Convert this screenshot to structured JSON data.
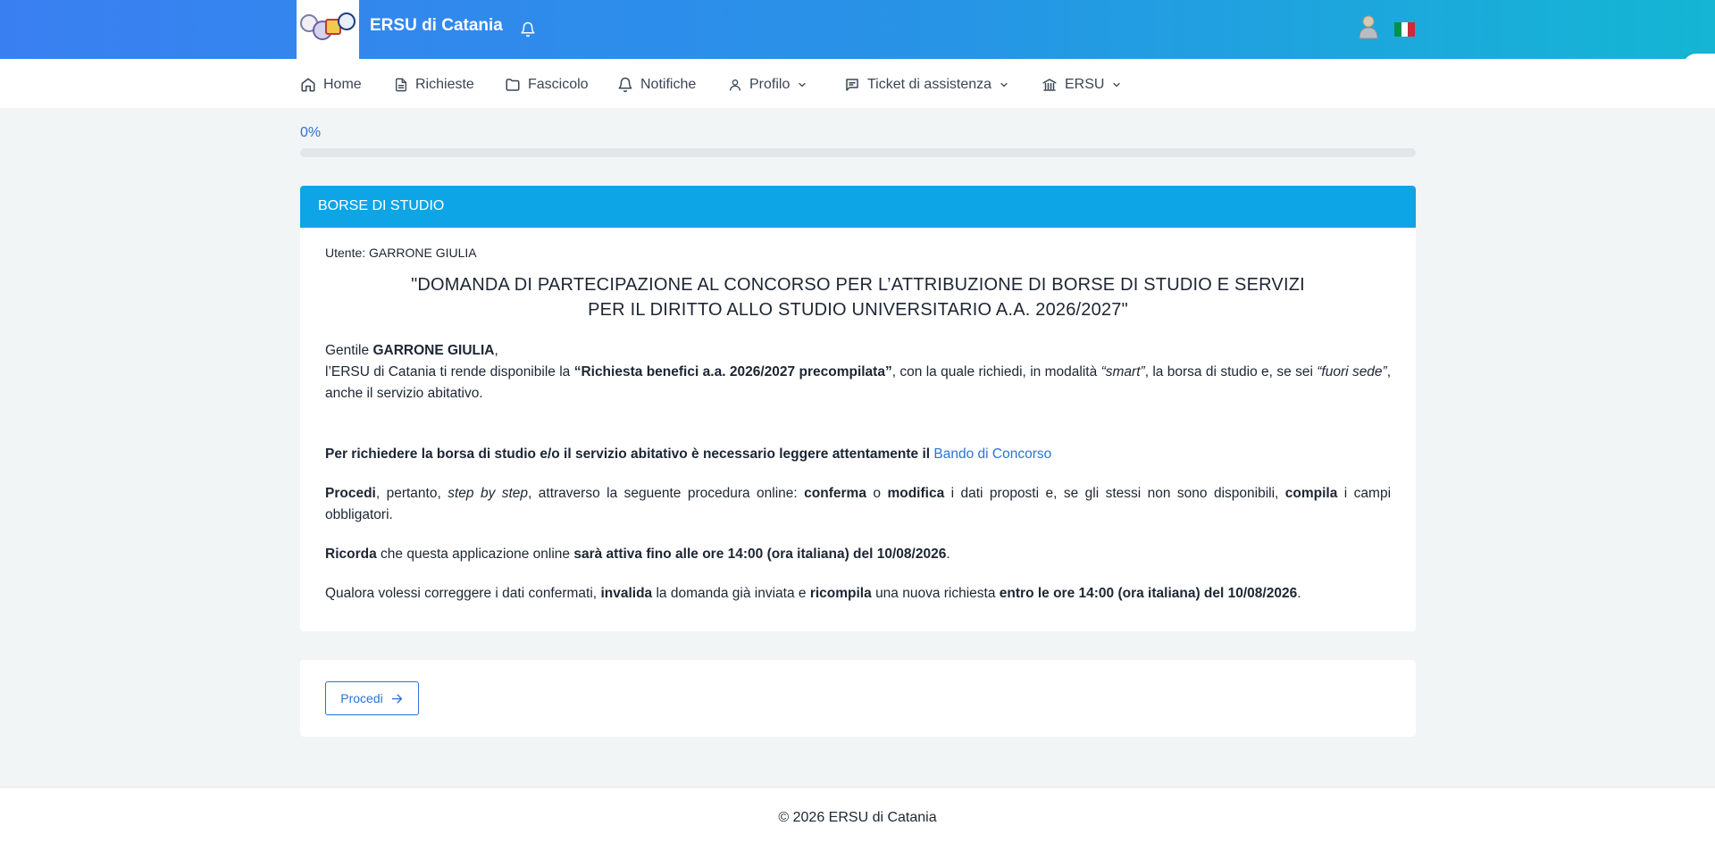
{
  "header": {
    "brand": "ERSU di Catania",
    "logo_icon": "ersu-logo",
    "notification_icon": "bell-icon",
    "user_icon": "user-avatar-icon",
    "language_icon": "italian-flag-icon"
  },
  "nav": {
    "items": [
      {
        "label": "Home",
        "icon": "home-icon"
      },
      {
        "label": "Richieste",
        "icon": "document-icon"
      },
      {
        "label": "Fascicolo",
        "icon": "folder-icon"
      },
      {
        "label": "Notifiche",
        "icon": "bell-icon"
      },
      {
        "label": "Profilo",
        "icon": "user-icon",
        "dropdown": true
      },
      {
        "label": "Ticket di assistenza",
        "icon": "chat-icon",
        "dropdown": true
      },
      {
        "label": "ERSU",
        "icon": "bank-icon",
        "dropdown": true
      }
    ]
  },
  "progress": {
    "label": "0%",
    "value": 0
  },
  "card": {
    "header": "BORSE DI STUDIO",
    "utente_label": "Utente:",
    "utente_name": "GARRONE GIULIA",
    "title_line1": "\"DOMANDA DI PARTECIPAZIONE AL CONCORSO PER L’ATTRIBUZIONE DI BORSE DI STUDIO E SERVIZI",
    "title_line2": "PER IL DIRITTO ALLO STUDIO UNIVERSITARIO A.A. 2026/2027\"",
    "greeting_prefix": "Gentile",
    "greeting_name": "GARRONE GIULIA",
    "greeting_suffix": ",",
    "intro_1": "l’ERSU di Catania ti rende disponibile la",
    "intro_bold": "“Richiesta benefici a.a. 2026/2027 precompilata”",
    "intro_2": ", con la quale richiedi, in modalità",
    "intro_smart": "“smart”",
    "intro_3": ", la borsa di studio e, se sei",
    "intro_fuori": "“fuori sede”",
    "intro_4": ", anche il servizio abitativo.",
    "bando_text": "Per richiedere la borsa di studio e/o il servizio abitativo è necessario leggere attentamente il",
    "bando_link": "Bando di Concorso",
    "procedi_bold": "Procedi",
    "procedi_1": ", pertanto,",
    "procedi_italic": "step by step",
    "procedi_2": ", attraverso la seguente procedura online:",
    "procedi_conferma": "conferma",
    "procedi_o": "o",
    "procedi_modifica": "modifica",
    "procedi_3": "i dati proposti e, se gli stessi non sono disponibili,",
    "procedi_compila": "compila",
    "procedi_4": "i campi obbligatori.",
    "ricorda_bold": "Ricorda",
    "ricorda_1": "che questa applicazione online",
    "ricorda_bold2": "sarà attiva fino alle ore 14:00 (ora italiana) del 10/08/2026",
    "ricorda_end": ".",
    "qualora_1": "Qualora volessi correggere i dati confermati,",
    "qualora_invalida": "invalida",
    "qualora_2": "la domanda già inviata e",
    "qualora_ricompila": "ricompila",
    "qualora_3": "una nuova richiesta",
    "qualora_bold": "entro le ore 14:00 (ora italiana) del 10/08/2026",
    "qualora_end": "."
  },
  "actions": {
    "procedi_label": "Procedi",
    "procedi_icon": "arrow-right-icon"
  },
  "footer": {
    "text": "© 2026 ERSU di Catania"
  },
  "colors": {
    "header_gradient_start": "#3a7ff2",
    "header_gradient_end": "#14b6d4",
    "card_header": "#0ea5e6",
    "accent": "#2b73d6",
    "background": "#f1f5f6"
  }
}
